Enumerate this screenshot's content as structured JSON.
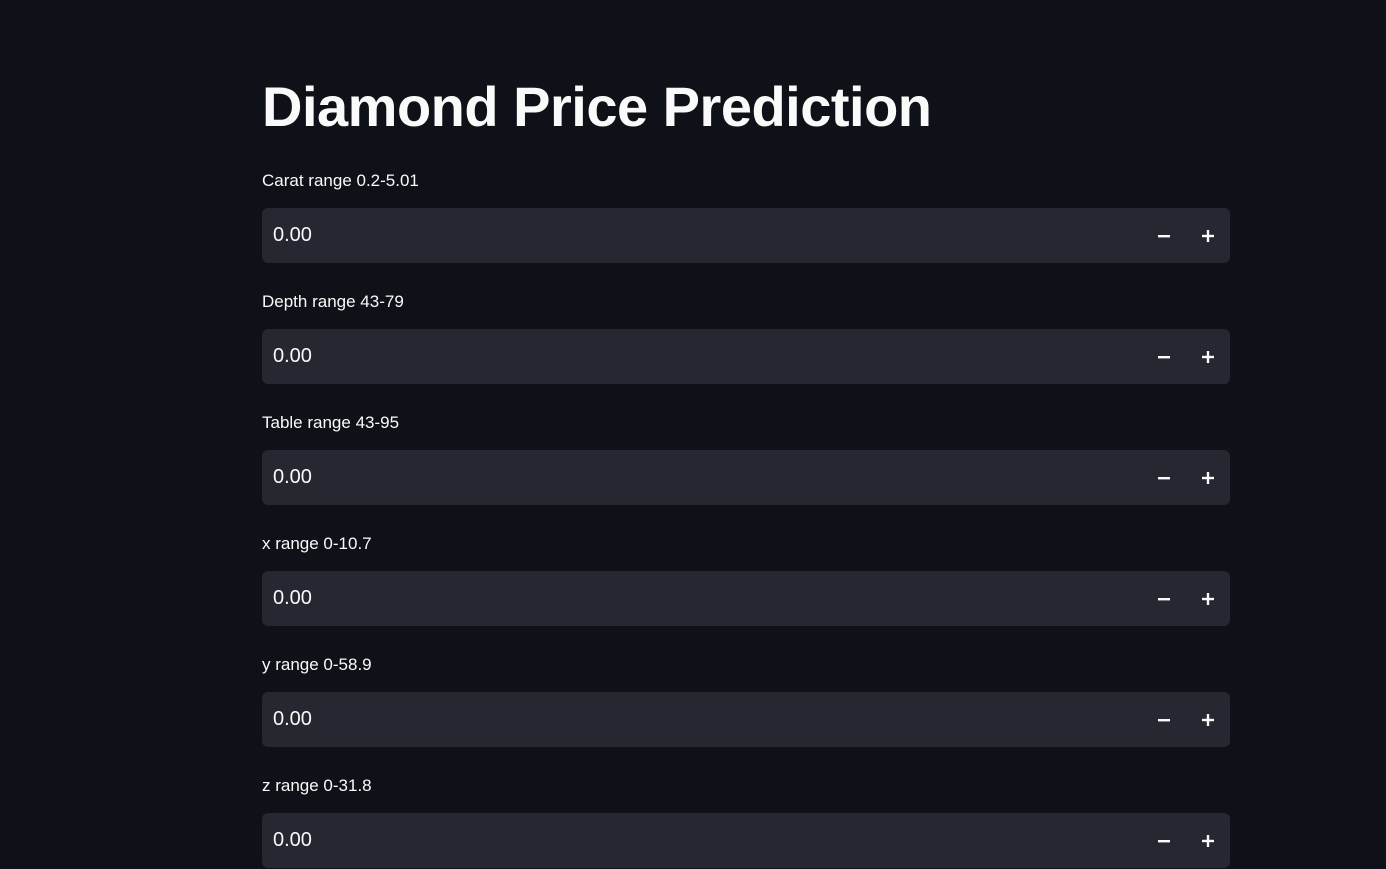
{
  "page": {
    "title": "Diamond Price Prediction"
  },
  "fields": [
    {
      "label": "Carat range 0.2-5.01",
      "value": "0.00"
    },
    {
      "label": "Depth range 43-79",
      "value": "0.00"
    },
    {
      "label": "Table range 43-95",
      "value": "0.00"
    },
    {
      "label": "x range 0-10.7",
      "value": "0.00"
    },
    {
      "label": "y range 0-58.9",
      "value": "0.00"
    },
    {
      "label": "z range 0-31.8",
      "value": "0.00"
    }
  ],
  "icons": {
    "decrement": "minus-icon",
    "increment": "plus-icon"
  },
  "colors": {
    "background": "#0e1117",
    "input_background": "#262730",
    "text": "#fafafa"
  }
}
